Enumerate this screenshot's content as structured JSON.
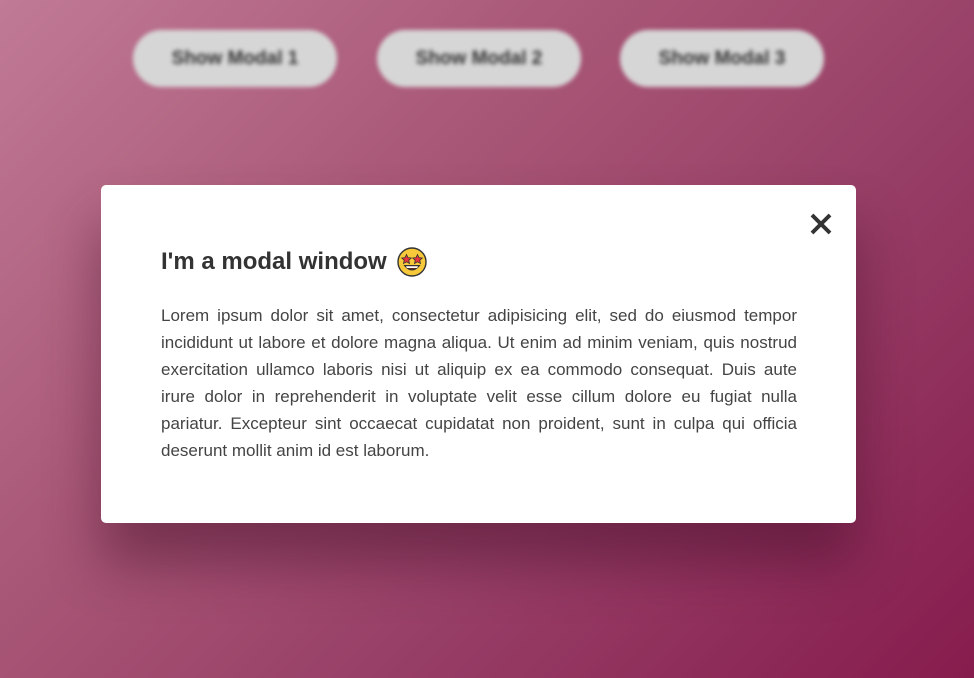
{
  "page": {
    "buttons": [
      "Show Modal 1",
      "Show Modal 2",
      "Show Modal 3"
    ]
  },
  "modal": {
    "title": "I'm a modal window",
    "title_emoji": "star-struck-emoji",
    "close_icon": "close-icon",
    "body": "Lorem ipsum dolor sit amet, consectetur adipisicing elit, sed do eiusmod tempor incididunt ut labore et dolore magna aliqua. Ut enim ad minim veniam, quis nostrud exercitation ullamco laboris nisi ut aliquip ex ea commodo consequat. Duis aute irure dolor in reprehenderit in voluptate velit esse cillum dolore eu fugiat nulla pariatur. Excepteur sint occaecat cupidatat non proident, sunt in culpa qui officia deserunt mollit anim id est laborum."
  },
  "colors": {
    "background_start": "#c07a95",
    "background_end": "#861c4d",
    "button_bg": "#d6d6d6",
    "modal_bg": "#ffffff",
    "title_text": "#333333"
  }
}
